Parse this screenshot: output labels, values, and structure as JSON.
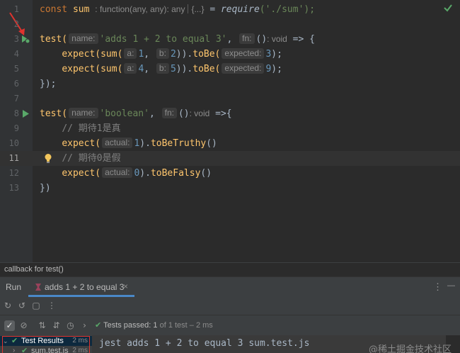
{
  "editor": {
    "line_numbers": [
      "1",
      "2",
      "3",
      "4",
      "5",
      "6",
      "7",
      "8",
      "9",
      "10",
      "11",
      "12",
      "13"
    ],
    "l1": {
      "const": "const",
      "var": "sum",
      "type_hint": ": function(any, any): any",
      "fold_hint": "{...}",
      "eq": " = ",
      "require": "require",
      "args": "('./sum');"
    },
    "l3": {
      "call": "test(",
      "name_hint": "name:",
      "str": "'adds 1 + 2 to equal 3'",
      "comma": ", ",
      "fn_hint": "fn:",
      "parens": "()",
      "void": ": void",
      "arrow": " => {"
    },
    "l4": {
      "expect": "expect(",
      "sum": "sum(",
      "a_hint": "a:",
      "a_val": "1",
      "comma": ",",
      "b_hint": "b:",
      "b_val": "2",
      "close": ")).",
      "toBe": "toBe(",
      "exp_hint": "expected:",
      "exp_val": "3",
      "end": ");"
    },
    "l5": {
      "expect": "expect(",
      "sum": "sum(",
      "a_hint": "a:",
      "a_val": "4",
      "comma": ",",
      "b_hint": "b:",
      "b_val": "5",
      "close": ")).",
      "toBe": "toBe(",
      "exp_hint": "expected:",
      "exp_val": "9",
      "end": ");"
    },
    "l6": "});",
    "l8": {
      "call": "test(",
      "name_hint": "name:",
      "str": "'boolean'",
      "comma": ", ",
      "fn_hint": "fn:",
      "parens": "()",
      "void": ": void",
      "arrow": " =>{"
    },
    "l9": "// 期待1是真",
    "l10": {
      "expect": "expect(",
      "act_hint": "actual:",
      "val": "1",
      "close": ").",
      "method": "toBeTruthy",
      "end": "()"
    },
    "l11": "// 期待0是假",
    "l12": {
      "expect": "expect(",
      "act_hint": "actual:",
      "val": "0",
      "close": ").",
      "method": "toBeFalsy",
      "end": "()"
    },
    "l13": "})"
  },
  "breadcrumb": "callback for test()",
  "run_panel": {
    "label": "Run",
    "tab_label": "adds 1 + 2 to equal 3",
    "tab_close": "×",
    "more": "⋮",
    "minimize": "—",
    "tests_passed": "Tests passed:",
    "passed_count": "1",
    "passed_detail": "of 1 test – 2 ms",
    "tree": [
      {
        "label": "Test Results",
        "time": "2 ms"
      },
      {
        "label": "sum.test.js",
        "time": "2 ms"
      }
    ],
    "console_cmd": "jest adds 1 + 2 to equal 3 sum.test.js"
  },
  "watermark": "@稀土掘金技术社区",
  "colors": {
    "accent": "#4a88c7",
    "pass": "#59a869",
    "highlight_box": "#e0332e"
  }
}
